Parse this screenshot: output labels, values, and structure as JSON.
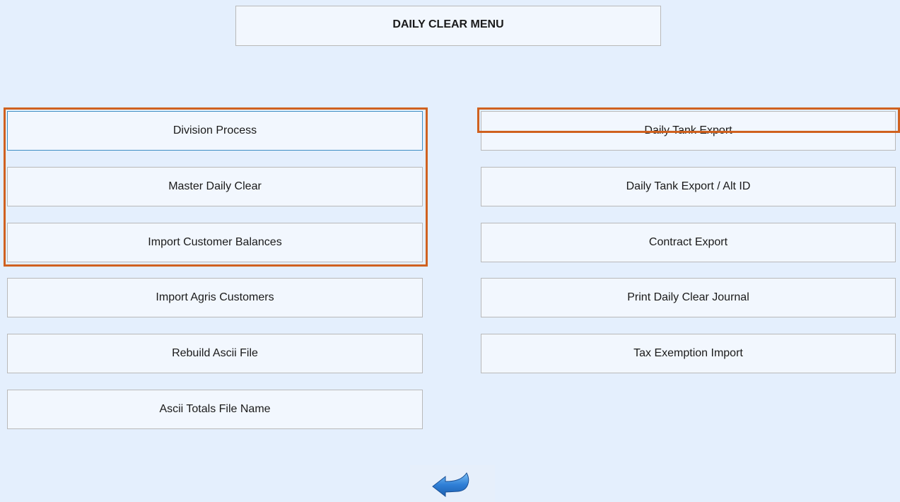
{
  "header": {
    "title": "DAILY CLEAR MENU"
  },
  "left_menu": [
    {
      "label": "Division Process"
    },
    {
      "label": "Master Daily Clear"
    },
    {
      "label": "Import Customer Balances"
    },
    {
      "label": "Import Agris Customers"
    },
    {
      "label": "Rebuild Ascii File"
    },
    {
      "label": "Ascii Totals File Name"
    }
  ],
  "right_menu": [
    {
      "label": "Daily Tank Export"
    },
    {
      "label": "Daily Tank Export / Alt ID"
    },
    {
      "label": "Contract Export"
    },
    {
      "label": "Print Daily Clear Journal"
    },
    {
      "label": "Tax Exemption Import"
    }
  ],
  "footer": {
    "back_icon": "back-arrow-icon"
  },
  "colors": {
    "background": "#e4effd",
    "button_bg": "#f2f7fe",
    "highlight": "#d0611f",
    "arrow": "#2f7fd6"
  }
}
